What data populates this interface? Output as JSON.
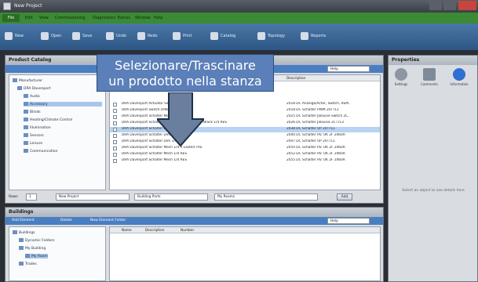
{
  "window": {
    "title": "New Project"
  },
  "menu": {
    "file": "File",
    "items": [
      "Edit",
      "View",
      "Commissioning",
      "Diagnostics",
      "Extras",
      "Window",
      "Help"
    ]
  },
  "toolbar": {
    "buttons": [
      "New",
      "Open",
      "Save",
      "Undo",
      "Redo",
      "Print",
      "Catalog",
      "Topology",
      "Reports"
    ]
  },
  "product_pane": {
    "title": "Product Catalog",
    "search_value": "Help",
    "tree": [
      {
        "label": "Manufacturer"
      },
      {
        "label": "DRA Davenport"
      },
      {
        "label": "Audio"
      },
      {
        "label": "Accessory"
      },
      {
        "label": "Blinds"
      },
      {
        "label": "Heating/Climate Control"
      },
      {
        "label": "Illumination"
      },
      {
        "label": "Sensors"
      },
      {
        "label": "Leisure"
      },
      {
        "label": "Communication"
      }
    ],
    "grid_header": [
      "Name",
      "Description"
    ],
    "rows": [
      {
        "name": "DRA Davenport Actuator Switch DIN4 RES",
        "desc": "2018 DC Anzeige/Actor, Switch, REM.."
      },
      {
        "name": "DRA Davenport Switch DIN4 RES",
        "desc": "2018 DC Schalter PWM 20TTL1"
      },
      {
        "name": "DRA Davenport Schalter Mech RES",
        "desc": "2025 DC Schalter Jalousie Switch 2C.."
      },
      {
        "name": "DRA Davenport Schalter Mech / Jalousieschalter Black 1/4 RES",
        "desc": "2026 DC Schalter Jalousie 2CTTL3"
      },
      {
        "name": "DRA Davenport Schalter Dim 1/4 UP",
        "desc": "2038 DC Schalter UP 20TTL1"
      },
      {
        "name": "DRA Davenport Schalter Dim 1/4 RES",
        "desc": "2040 DC Schalter RV. UK 2F 2060A"
      },
      {
        "name": "DRA Davenport Schalter Dim 1/4 UP",
        "desc": "2047 DC Schalter UP 20TTL1"
      },
      {
        "name": "DRA Davenport Schalter Mech 1/4 0 Lasted TAS",
        "desc": "2050 DC Schalter RV. UK 2F 2060A"
      },
      {
        "name": "DRA Davenport Schalter Mech 1/4 RES",
        "desc": "2052 DC Schalter RV. UK 2F 2060A"
      },
      {
        "name": "DRA Davenport Schalter Mech 1/4 RES",
        "desc": "2055 DC Schalter RV. UK 2F 2060A"
      }
    ],
    "footer": {
      "label": "Rows",
      "count": "1",
      "project_field": "New Project",
      "building_field": "Building Parts",
      "room_field": "My Rooms",
      "add_button": "Add"
    }
  },
  "callout": {
    "line1": "Selezionare/Trascinare",
    "line2": "un prodotto nella stanza"
  },
  "buildings_pane": {
    "title": "Buildings",
    "toolbar": [
      "Add Element",
      "Delete",
      "New Element Folder"
    ],
    "search_value": "Help",
    "tree": [
      {
        "label": "Buildings"
      },
      {
        "label": "Dynamic Folders"
      },
      {
        "label": "My Building"
      },
      {
        "label": "My Room"
      },
      {
        "label": "Trades"
      }
    ],
    "columns": [
      "Name",
      "Description",
      "Number"
    ]
  },
  "properties_pane": {
    "title": "Properties",
    "tabs": [
      "Settings",
      "Comments",
      "Information"
    ],
    "empty_text": "Select an object to see details here"
  }
}
